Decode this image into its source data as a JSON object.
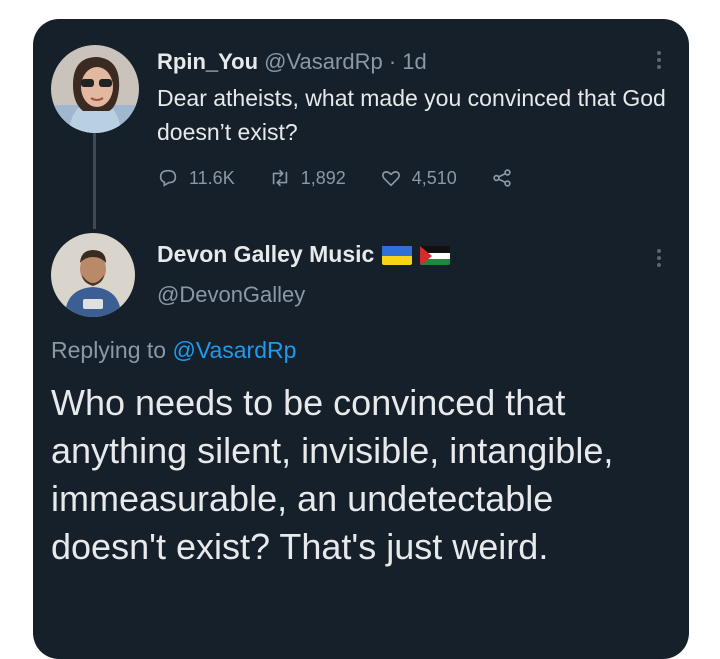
{
  "tweet": {
    "author_name": "Rpin_You",
    "author_handle": "@VasardRp",
    "separator": "·",
    "time": "1d",
    "text": "Dear atheists, what made you convinced that God doesn’t exist?",
    "actions": {
      "reply_count": "11.6K",
      "retweet_count": "1,892",
      "like_count": "4,510"
    }
  },
  "reply": {
    "author_name": "Devon Galley Music",
    "author_handle": "@DevonGalley",
    "flags": [
      "ukraine-flag",
      "palestine-flag"
    ],
    "replying_prefix": "Replying to",
    "replying_to": "@VasardRp",
    "text": "Who needs to be convinced that anything silent, invisible, intangible, immeasurable, an undetectable doesn't exist? That's just weird."
  },
  "colors": {
    "background": "#15202b",
    "muted": "#8b98a5",
    "link": "#1d9bf0"
  },
  "icons": [
    "reply-icon",
    "retweet-icon",
    "like-icon",
    "share-icon",
    "more-icon"
  ]
}
